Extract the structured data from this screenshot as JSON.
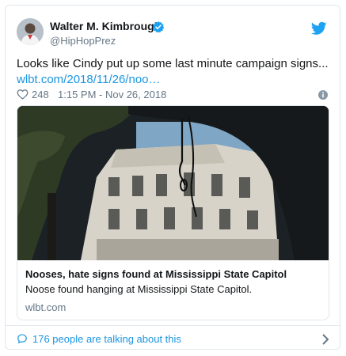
{
  "user": {
    "display_name": "Walter M. Kimbrough",
    "handle": "@HipHopPrez"
  },
  "tweet": {
    "text": "Looks like Cindy put up some last minute campaign signs...",
    "link": "wlbt.com/2018/11/26/noo…"
  },
  "meta": {
    "likes": "248",
    "timestamp": "1:15 PM - Nov 26, 2018"
  },
  "card": {
    "title": "Nooses, hate signs found at Mississippi State Capitol",
    "description": "Noose found hanging at Mississippi State Capitol.",
    "domain": "wlbt.com"
  },
  "footer": {
    "conversation": "176 people are talking about this"
  },
  "colors": {
    "link_blue": "#1b95e0",
    "verified_blue": "#1da1f2",
    "text_gray": "#657786",
    "border": "#e1e8ed"
  },
  "icons": [
    "verified-icon",
    "twitter-icon",
    "heart-icon",
    "info-icon",
    "comment-icon",
    "chevron-right-icon"
  ]
}
